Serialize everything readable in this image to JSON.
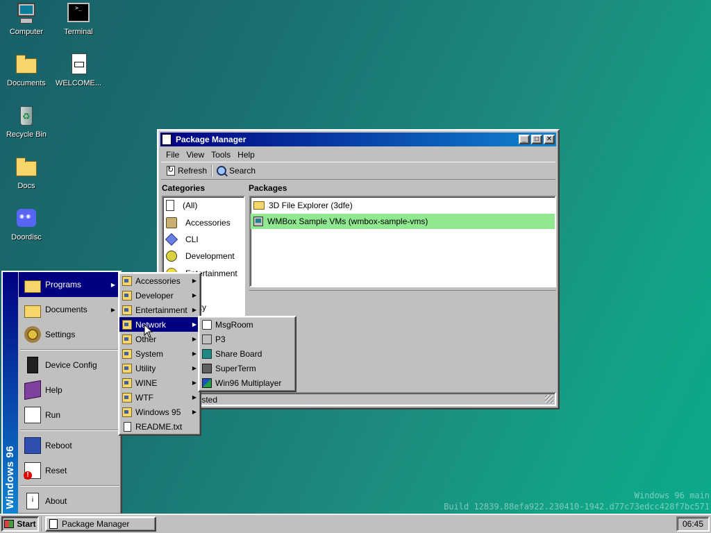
{
  "desktop": {
    "icons": [
      {
        "label": "Computer"
      },
      {
        "label": "Terminal"
      },
      {
        "label": "Documents"
      },
      {
        "label": "WELCOME..."
      },
      {
        "label": "Recycle Bin"
      },
      {
        "label": "Docs"
      },
      {
        "label": "Doordisc"
      }
    ]
  },
  "window": {
    "title": "Package Manager",
    "menu": [
      "File",
      "View",
      "Tools",
      "Help"
    ],
    "toolbar": {
      "refresh": "Refresh",
      "search": "Search"
    },
    "categories_header": "Categories",
    "packages_header": "Packages",
    "categories": [
      "(All)",
      "Accessories",
      "CLI",
      "Development",
      "Entertainment",
      "ies",
      "ctivity"
    ],
    "packages": [
      {
        "name": "3D File Explorer (3dfe)",
        "selected": false
      },
      {
        "name": "WMBox Sample VMs (wmbox-sample-vms)",
        "selected": true
      }
    ],
    "status": "listed"
  },
  "start_menu": {
    "brand": "Windows 96",
    "items": [
      {
        "label": "Programs",
        "submenu": true
      },
      {
        "label": "Documents",
        "submenu": true
      },
      {
        "label": "Settings",
        "submenu": false
      },
      {
        "label": "Device Config",
        "submenu": false
      },
      {
        "label": "Help",
        "submenu": false
      },
      {
        "label": "Run",
        "submenu": false
      },
      {
        "label": "Reboot",
        "submenu": false
      },
      {
        "label": "Reset",
        "submenu": false
      },
      {
        "label": "About",
        "submenu": false
      }
    ]
  },
  "programs_menu": {
    "items": [
      "Accessories",
      "Developer",
      "Entertainment",
      "Network",
      "Other",
      "System",
      "Utility",
      "WINE",
      "WTF",
      "Windows 95",
      "README.txt"
    ],
    "active": "Network"
  },
  "network_menu": {
    "items": [
      "MsgRoom",
      "P3",
      "Share Board",
      "SuperTerm",
      "Win96 Multiplayer"
    ]
  },
  "watermark": {
    "line1": "Windows 96 main",
    "line2": "Build 12839.88efa922.230410-1942.d77c73edcc428f7bc571"
  },
  "taskbar": {
    "start": "Start",
    "task": "Package Manager",
    "clock": "06:45"
  },
  "colors": {
    "title_active": "#000080",
    "selection": "#90e890",
    "desktop": "#1a7a74"
  }
}
